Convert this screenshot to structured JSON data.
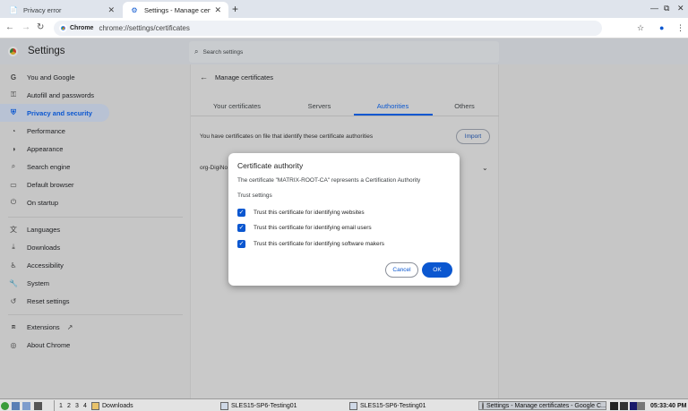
{
  "browser": {
    "tabs": [
      {
        "title": "Privacy error",
        "active": false
      },
      {
        "title": "Settings - Manage certificates",
        "active": true
      }
    ],
    "chip": "Chrome",
    "url": "chrome://settings/certificates"
  },
  "settings": {
    "title": "Settings",
    "search_placeholder": "Search settings",
    "sidebar": [
      {
        "label": "You and Google",
        "icon": "google-g-icon"
      },
      {
        "label": "Autofill and passwords",
        "icon": "key-icon"
      },
      {
        "label": "Privacy and security",
        "icon": "shield-icon",
        "active": true
      },
      {
        "label": "Performance",
        "icon": "speedometer-icon"
      },
      {
        "label": "Appearance",
        "icon": "palette-icon"
      },
      {
        "label": "Search engine",
        "icon": "search-icon"
      },
      {
        "label": "Default browser",
        "icon": "browser-window-icon"
      },
      {
        "label": "On startup",
        "icon": "power-icon"
      },
      {
        "label": "Languages",
        "icon": "translate-icon"
      },
      {
        "label": "Downloads",
        "icon": "download-icon"
      },
      {
        "label": "Accessibility",
        "icon": "accessibility-icon"
      },
      {
        "label": "System",
        "icon": "wrench-icon"
      },
      {
        "label": "Reset settings",
        "icon": "reset-icon"
      },
      {
        "label": "Extensions",
        "icon": "puzzle-icon",
        "external": true
      },
      {
        "label": "About Chrome",
        "icon": "chrome-icon"
      }
    ]
  },
  "certificates": {
    "title": "Manage certificates",
    "tabs": [
      "Your certificates",
      "Servers",
      "Authorities",
      "Others"
    ],
    "active_tab": "Authorities",
    "info": "You have certificates on file that identify these certificate authorities",
    "import_label": "Import",
    "org_row": "org-DigiNo"
  },
  "dialog": {
    "title": "Certificate authority",
    "description": "The certificate \"MATRIX-ROOT-CA\" represents a Certification Authority",
    "subheading": "Trust settings",
    "options": [
      {
        "label": "Trust this certificate for identifying websites",
        "checked": true
      },
      {
        "label": "Trust this certificate for identifying email users",
        "checked": true
      },
      {
        "label": "Trust this certificate for identifying software makers",
        "checked": true
      }
    ],
    "cancel_label": "Cancel",
    "ok_label": "OK"
  },
  "taskbar": {
    "workspaces": [
      "1",
      "2",
      "3",
      "4"
    ],
    "downloads_label": "Downloads",
    "task1": "SLES15-SP6-Testing01",
    "task2": "SLES15-SP6-Testing01",
    "task3": "Settings - Manage certificates - Google C...",
    "clock": "05:33:40 PM"
  },
  "colors": {
    "accent": "#0b57d0",
    "dim_background": "#c6c6c6"
  }
}
